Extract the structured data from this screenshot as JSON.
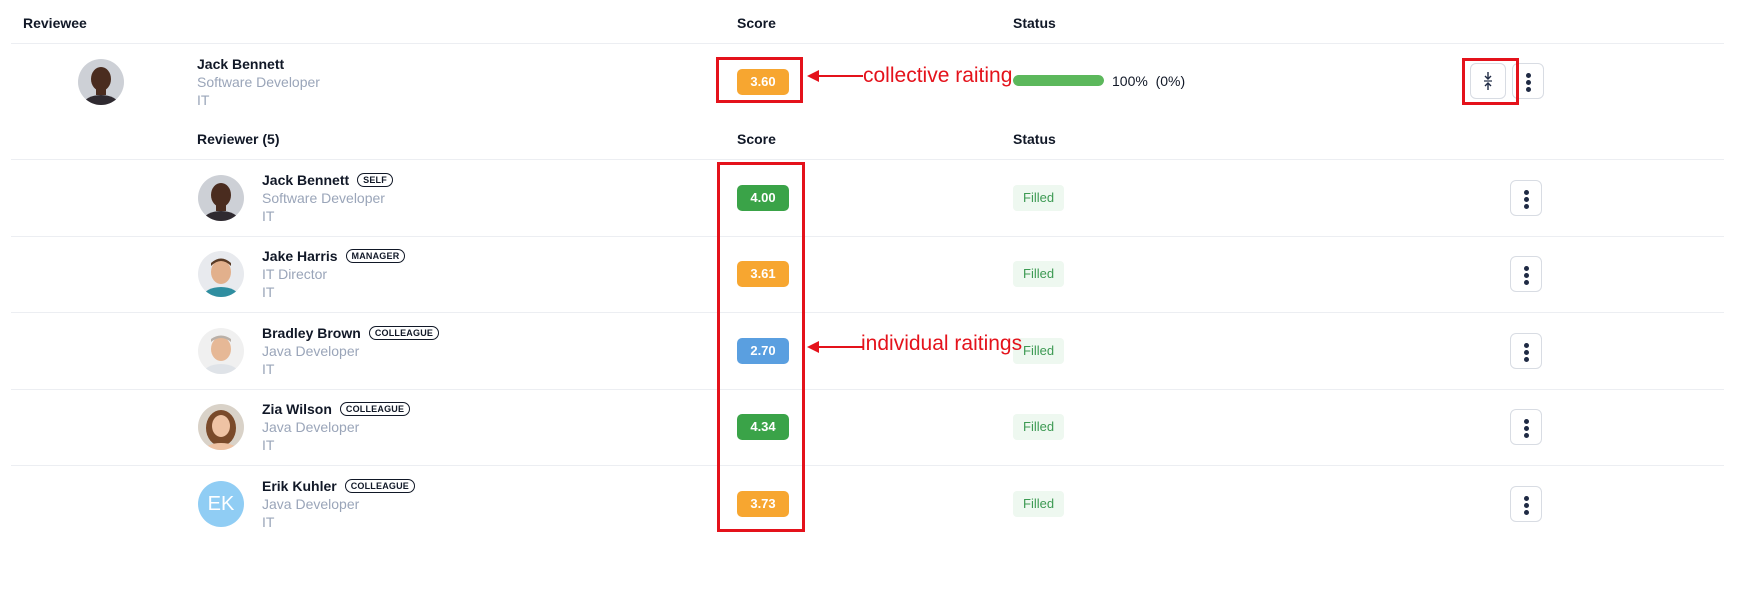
{
  "headers": {
    "reviewee": "Reviewee",
    "score": "Score",
    "status": "Status"
  },
  "reviewee": {
    "name": "Jack Bennett",
    "title": "Software Developer",
    "dept": "IT",
    "score": "3.60",
    "progress_value": 1.0,
    "progress_text": "100%",
    "progress_extra": "(0%)",
    "collapse_icon": "collapse-vertical-icon",
    "menu_icon": "more-vertical-icon"
  },
  "reviewers_section": {
    "header": "Reviewer (5)",
    "score": "Score",
    "status": "Status"
  },
  "reviewers": [
    {
      "name": "Jack Bennett",
      "role": "SELF",
      "title": "Software Developer",
      "dept": "IT",
      "score": "4.00",
      "status": "Filled",
      "score_color": "#3aa348"
    },
    {
      "name": "Jake Harris",
      "role": "MANAGER",
      "title": "IT Director",
      "dept": "IT",
      "score": "3.61",
      "status": "Filled",
      "score_color": "#f7a630"
    },
    {
      "name": "Bradley Brown",
      "role": "COLLEAGUE",
      "title": "Java Developer",
      "dept": "IT",
      "score": "2.70",
      "status": "Filled",
      "score_color": "#5a9fe0"
    },
    {
      "name": "Zia Wilson",
      "role": "COLLEAGUE",
      "title": "Java Developer",
      "dept": "IT",
      "score": "4.34",
      "status": "Filled",
      "score_color": "#3aa348"
    },
    {
      "name": "Erik Kuhler",
      "role": "COLLEAGUE",
      "title": "Java Developer",
      "dept": "IT",
      "score": "3.73",
      "status": "Filled",
      "score_color": "#f7a630",
      "initials": "EK"
    }
  ],
  "annotations": {
    "collective": "collective raiting",
    "individual": "individual raitings"
  },
  "colors": {
    "annotation_red": "#e4121b",
    "progress_green": "#5cb85c",
    "score_orange": "#f7a630"
  }
}
